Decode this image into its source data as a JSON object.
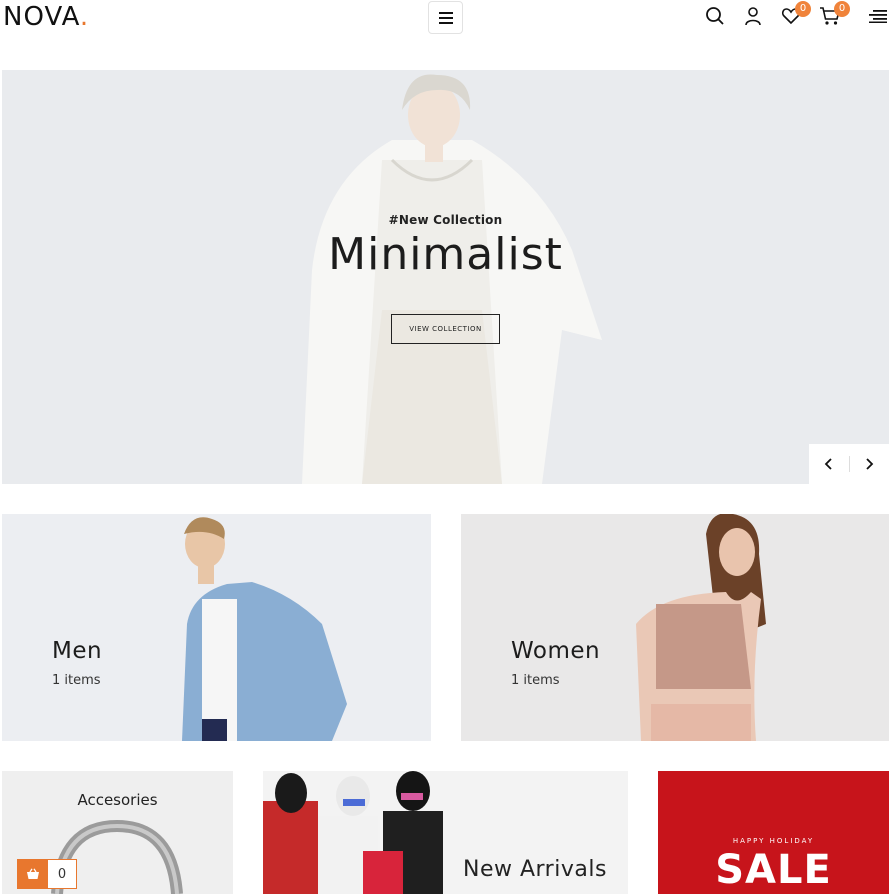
{
  "header": {
    "logo_text": "NOVA",
    "logo_dot": ".",
    "wishlist_count": "0",
    "cart_count": "0"
  },
  "hero": {
    "tag": "#New Collection",
    "title": "Minimalist",
    "cta_label": "VIEW COLLECTION",
    "prev_icon": "chevron-left-icon",
    "next_icon": "chevron-right-icon"
  },
  "categories": [
    {
      "title": "Men",
      "count": "1 items"
    },
    {
      "title": "Women",
      "count": "1 items"
    }
  ],
  "tiles": {
    "accessories_title": "Accesories",
    "new_arrivals_title": "New Arrivals",
    "sale_small": "HAPPY HOLIDAY",
    "sale_big": "SALE"
  },
  "floating_cart": {
    "count": "0"
  },
  "colors": {
    "accent": "#e8772e",
    "sale_red": "#c7141b",
    "hero_bg": "#e9ebee"
  }
}
